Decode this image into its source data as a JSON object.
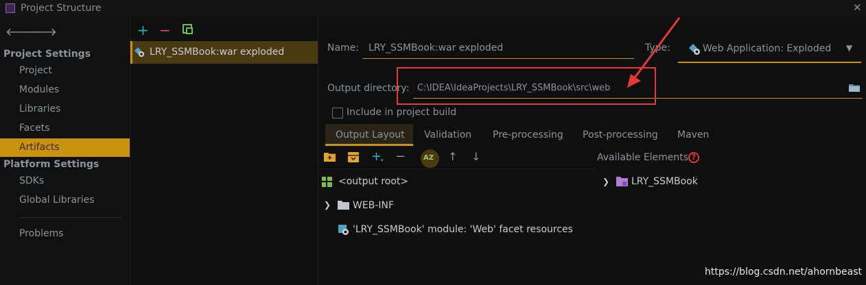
{
  "window": {
    "title": "Project Structure",
    "close_glyph": "✕"
  },
  "nav": {
    "back_glyph": "🡐",
    "forward_glyph": "🡒",
    "project_settings_header": "Project Settings",
    "project_items": [
      "Project",
      "Modules",
      "Libraries",
      "Facets",
      "Artifacts"
    ],
    "platform_settings_header": "Platform Settings",
    "platform_items": [
      "SDKs",
      "Global Libraries"
    ],
    "problems": "Problems",
    "selected": "Artifacts"
  },
  "artifact_list": {
    "toolbar": {
      "add_glyph": "+",
      "remove_glyph": "−"
    },
    "items": [
      {
        "label": "LRY_SSMBook:war exploded"
      }
    ]
  },
  "details": {
    "name_label": "Name:",
    "name_value": "LRY_SSMBook:war exploded",
    "type_label": "Type:",
    "type_value": "Web Application: Exploded",
    "type_arrow": "▼",
    "output_dir_label": "Output directory:",
    "output_dir_value": "C:\\IDEA\\IdeaProjects\\LRY_SSMBook\\src\\web",
    "include_in_build_label": "Include in project build",
    "include_in_build_checked": false
  },
  "tabs": [
    "Output Layout",
    "Validation",
    "Pre-processing",
    "Post-processing",
    "Maven"
  ],
  "active_tab": "Output Layout",
  "layout_toolbar": {
    "add_glyph": "+",
    "caret_glyph": "▾",
    "remove_glyph": "−",
    "sort_glyph": "AZ",
    "up_glyph": "↑",
    "down_glyph": "↓"
  },
  "output_tree": [
    {
      "label": "<output root>",
      "icon": "output-root-icon"
    },
    {
      "label": "WEB-INF",
      "icon": "folder-icon",
      "expander": "❯"
    },
    {
      "label": "'LRY_SSMBook' module: 'Web' facet resources",
      "icon": "web-facet-icon"
    }
  ],
  "available": {
    "label": "Available Elements",
    "help_glyph": "?",
    "items": [
      {
        "label": "LRY_SSMBook",
        "expander": "❯"
      }
    ]
  },
  "watermark": "https://blog.csdn.net/ahornbeast",
  "colors": {
    "accent": "#c9920f",
    "annotation_red": "#e53935",
    "add_teal": "#20b3c2",
    "remove_red": "#e0505a"
  }
}
